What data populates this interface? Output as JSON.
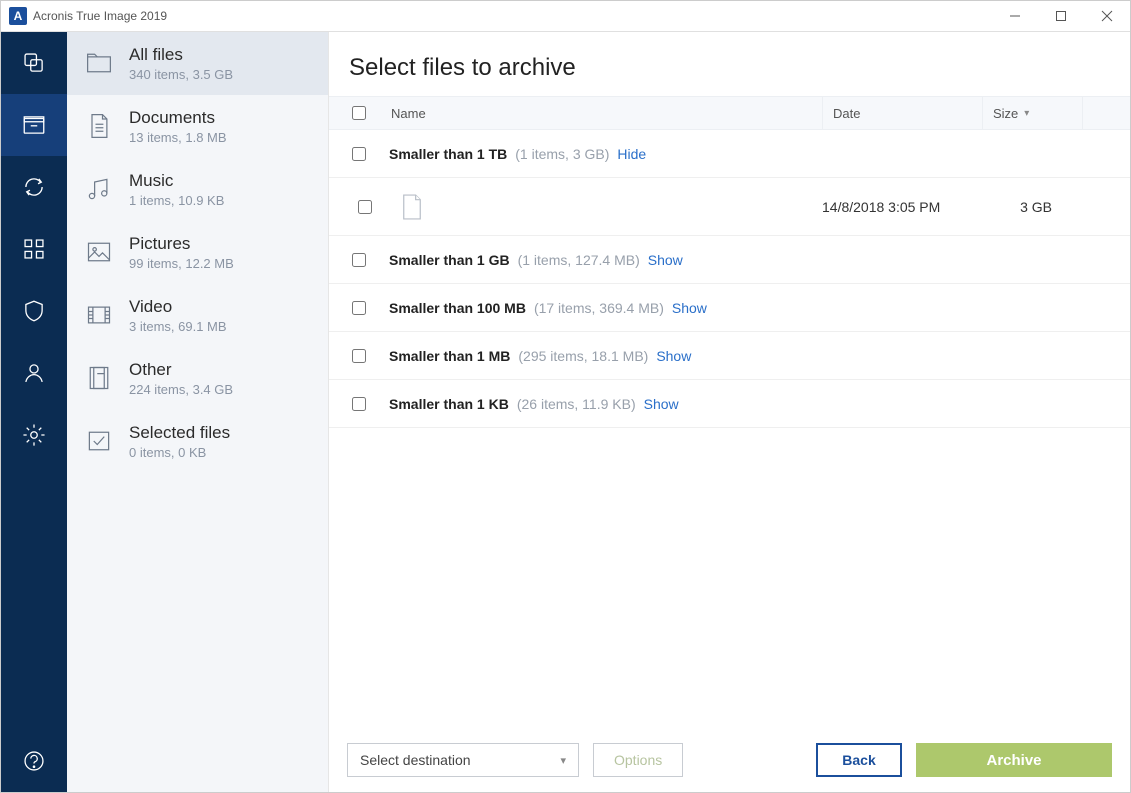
{
  "window": {
    "title": "Acronis True Image 2019",
    "app_icon_letter": "A"
  },
  "rail": {
    "items": [
      {
        "name": "backup",
        "active": false
      },
      {
        "name": "archive",
        "active": true
      },
      {
        "name": "sync",
        "active": false
      },
      {
        "name": "tools",
        "active": false
      },
      {
        "name": "active-protection",
        "active": false
      },
      {
        "name": "account",
        "active": false
      },
      {
        "name": "settings",
        "active": false
      }
    ],
    "help": {
      "name": "help"
    }
  },
  "categories": [
    {
      "key": "all",
      "title": "All files",
      "sub": "340 items, 3.5 GB",
      "icon": "folder",
      "active": true
    },
    {
      "key": "documents",
      "title": "Documents",
      "sub": "13 items, 1.8 MB",
      "icon": "document",
      "active": false
    },
    {
      "key": "music",
      "title": "Music",
      "sub": "1 items, 10.9 KB",
      "icon": "music",
      "active": false
    },
    {
      "key": "pictures",
      "title": "Pictures",
      "sub": "99 items, 12.2 MB",
      "icon": "picture",
      "active": false
    },
    {
      "key": "video",
      "title": "Video",
      "sub": "3 items, 69.1 MB",
      "icon": "video",
      "active": false
    },
    {
      "key": "other",
      "title": "Other",
      "sub": "224 items, 3.4 GB",
      "icon": "other",
      "active": false
    },
    {
      "key": "selected",
      "title": "Selected files",
      "sub": "0 items, 0 KB",
      "icon": "selected",
      "active": false
    }
  ],
  "main": {
    "heading": "Select files to archive",
    "columns": {
      "name": "Name",
      "date": "Date",
      "size": "Size"
    },
    "groups": [
      {
        "title": "Smaller than 1 TB",
        "meta": "(1 items, 3 GB)",
        "link": "Hide",
        "expanded": true,
        "files": [
          {
            "name": "",
            "date": "14/8/2018 3:05 PM",
            "size": "3 GB"
          }
        ]
      },
      {
        "title": "Smaller than 1 GB",
        "meta": "(1 items, 127.4 MB)",
        "link": "Show",
        "expanded": false,
        "files": []
      },
      {
        "title": "Smaller than 100 MB",
        "meta": "(17 items, 369.4 MB)",
        "link": "Show",
        "expanded": false,
        "files": []
      },
      {
        "title": "Smaller than 1 MB",
        "meta": "(295 items, 18.1 MB)",
        "link": "Show",
        "expanded": false,
        "files": []
      },
      {
        "title": "Smaller than 1 KB",
        "meta": "(26 items, 11.9 KB)",
        "link": "Show",
        "expanded": false,
        "files": []
      }
    ]
  },
  "footer": {
    "destination_placeholder": "Select destination",
    "options": "Options",
    "back": "Back",
    "archive": "Archive"
  }
}
